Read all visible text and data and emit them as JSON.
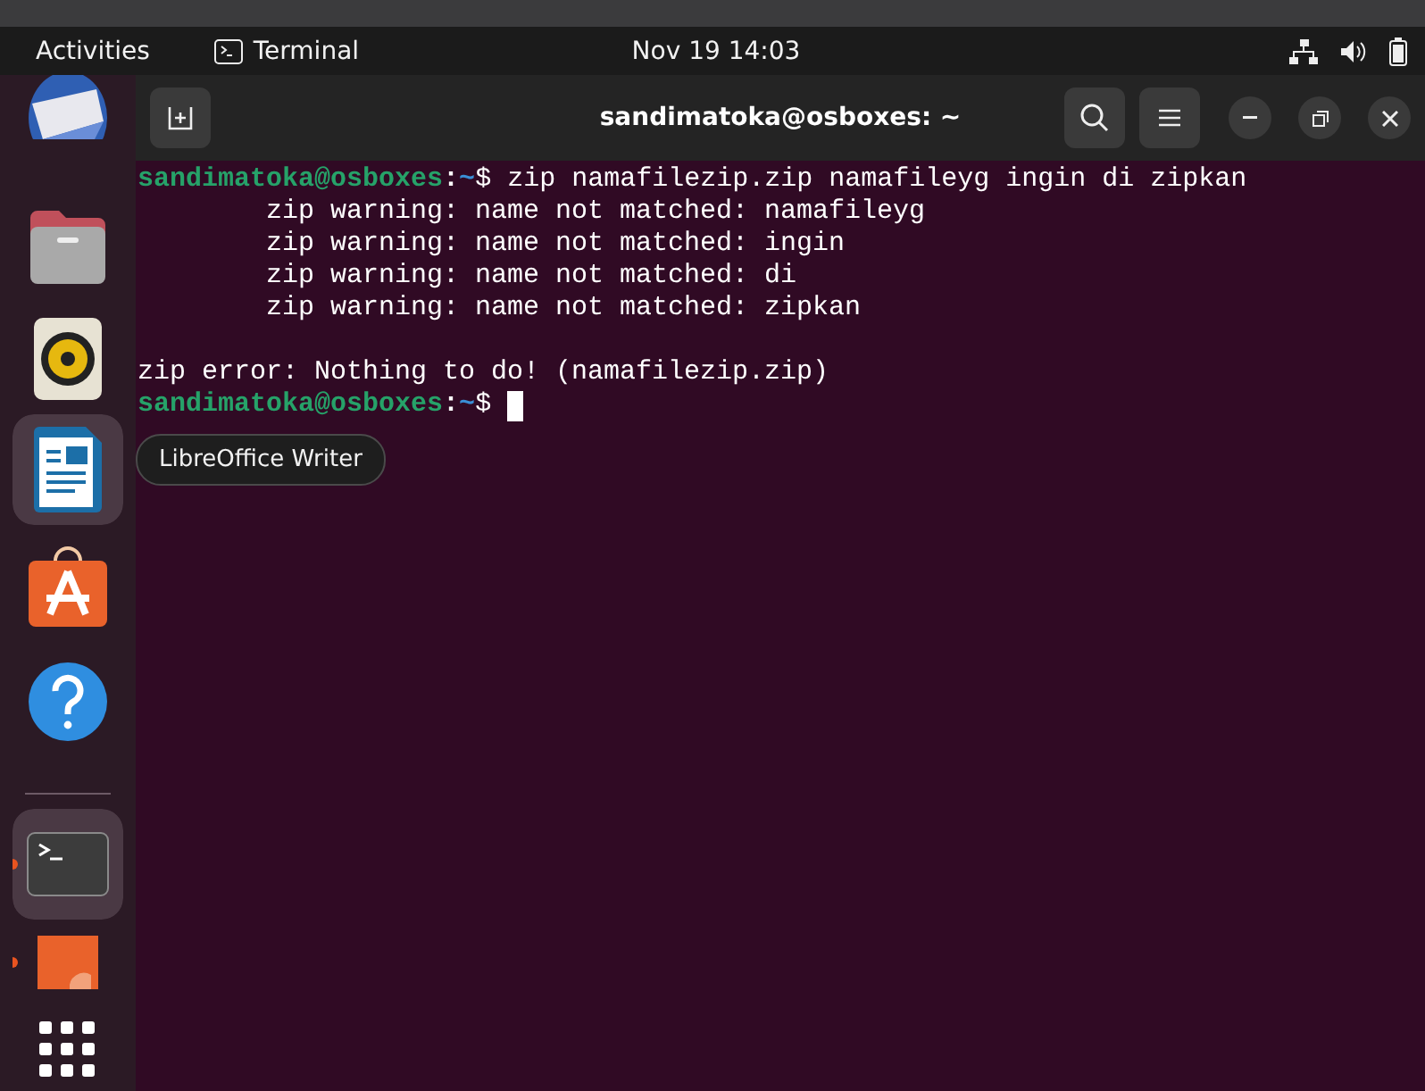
{
  "top_bar": {
    "activities": "Activities",
    "app_menu": "Terminal",
    "clock": "Nov 19  14:03"
  },
  "dock": {
    "items": [
      {
        "kind": "mail",
        "selected": false,
        "running": false
      },
      {
        "kind": "files",
        "selected": false,
        "running": false
      },
      {
        "kind": "music",
        "selected": false,
        "running": false
      },
      {
        "kind": "writer",
        "selected": true,
        "running": false
      },
      {
        "kind": "store",
        "selected": false,
        "running": false
      },
      {
        "kind": "help",
        "selected": false,
        "running": false
      },
      {
        "kind": "separator"
      },
      {
        "kind": "terminal",
        "selected": true,
        "running": true
      },
      {
        "kind": "orange",
        "selected": false,
        "running": true
      },
      {
        "kind": "grid",
        "selected": false,
        "running": false
      }
    ]
  },
  "window": {
    "title": "sandimatoka@osboxes: ~"
  },
  "terminal": {
    "lines": [
      {
        "kind": "prompt",
        "indented": false,
        "cursor": false,
        "segments": [
          {
            "text": "sandimatoka@osboxes",
            "color": "#26a269",
            "bold": true
          },
          {
            "text": ":",
            "color": "#ffffff",
            "bold": true
          },
          {
            "text": "~",
            "color": "#3a8fd6",
            "bold": true
          },
          {
            "text": "$ zip namafilezip.zip namafileyg ingin di zipkan",
            "color": "#ffffff",
            "bold": false
          }
        ]
      },
      {
        "kind": "output",
        "indented": true,
        "cursor": false,
        "text": "zip warning: name not matched: namafileyg"
      },
      {
        "kind": "output",
        "indented": true,
        "cursor": false,
        "text": "zip warning: name not matched: ingin"
      },
      {
        "kind": "output",
        "indented": true,
        "cursor": false,
        "text": "zip warning: name not matched: di"
      },
      {
        "kind": "output",
        "indented": true,
        "cursor": false,
        "text": "zip warning: name not matched: zipkan"
      },
      {
        "kind": "blank"
      },
      {
        "kind": "output",
        "indented": false,
        "cursor": false,
        "text": "zip error: Nothing to do! (namafilezip.zip)"
      },
      {
        "kind": "prompt",
        "indented": false,
        "cursor": true,
        "segments": [
          {
            "text": "sandimatoka@osboxes",
            "color": "#26a269",
            "bold": true
          },
          {
            "text": ":",
            "color": "#ffffff",
            "bold": true
          },
          {
            "text": "~",
            "color": "#3a8fd6",
            "bold": true
          },
          {
            "text": "$ ",
            "color": "#ffffff",
            "bold": false
          }
        ]
      }
    ]
  },
  "tooltip": {
    "text": "LibreOffice Writer"
  }
}
